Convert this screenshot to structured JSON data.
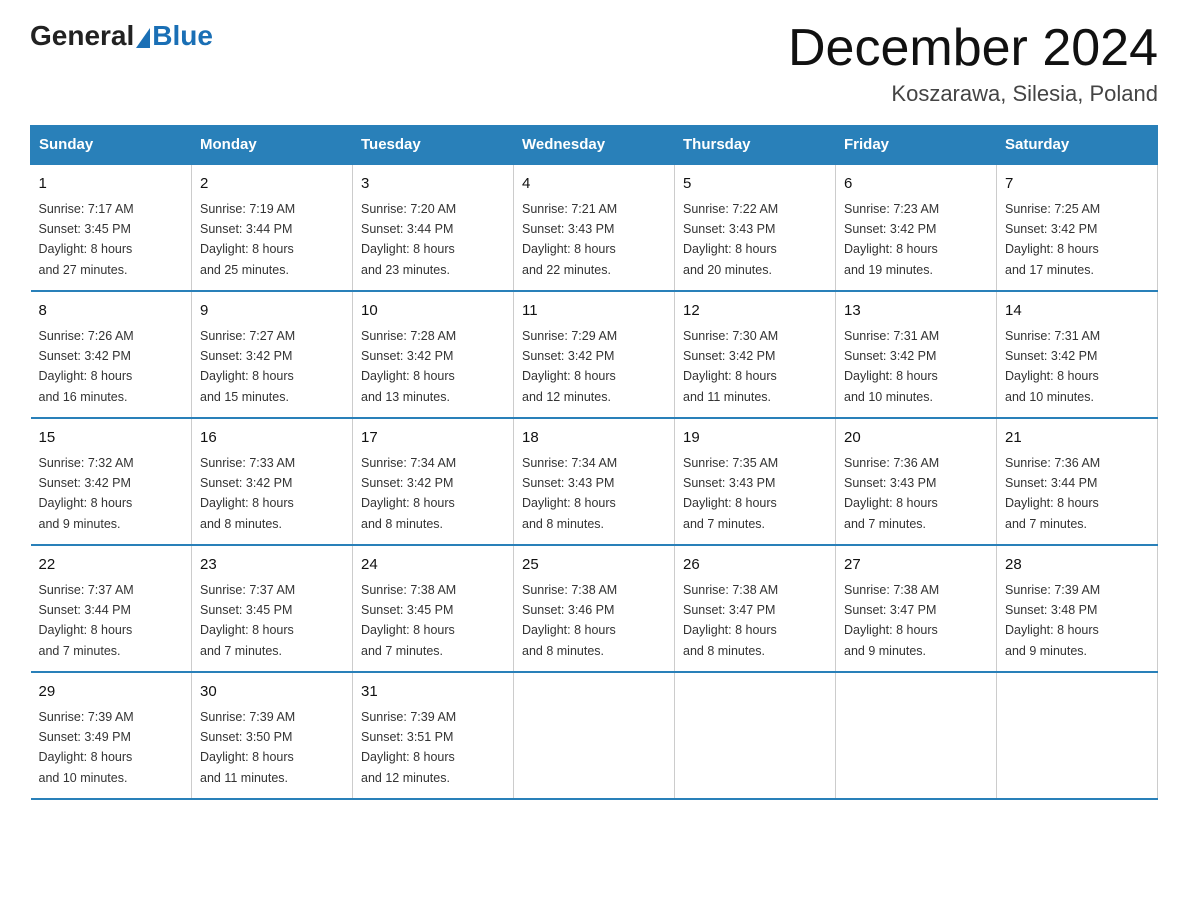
{
  "header": {
    "logo_general": "General",
    "logo_blue": "Blue",
    "title": "December 2024",
    "subtitle": "Koszarawa, Silesia, Poland"
  },
  "weekdays": [
    "Sunday",
    "Monday",
    "Tuesday",
    "Wednesday",
    "Thursday",
    "Friday",
    "Saturday"
  ],
  "weeks": [
    [
      {
        "day": "1",
        "sunrise": "7:17 AM",
        "sunset": "3:45 PM",
        "daylight": "8 hours and 27 minutes."
      },
      {
        "day": "2",
        "sunrise": "7:19 AM",
        "sunset": "3:44 PM",
        "daylight": "8 hours and 25 minutes."
      },
      {
        "day": "3",
        "sunrise": "7:20 AM",
        "sunset": "3:44 PM",
        "daylight": "8 hours and 23 minutes."
      },
      {
        "day": "4",
        "sunrise": "7:21 AM",
        "sunset": "3:43 PM",
        "daylight": "8 hours and 22 minutes."
      },
      {
        "day": "5",
        "sunrise": "7:22 AM",
        "sunset": "3:43 PM",
        "daylight": "8 hours and 20 minutes."
      },
      {
        "day": "6",
        "sunrise": "7:23 AM",
        "sunset": "3:42 PM",
        "daylight": "8 hours and 19 minutes."
      },
      {
        "day": "7",
        "sunrise": "7:25 AM",
        "sunset": "3:42 PM",
        "daylight": "8 hours and 17 minutes."
      }
    ],
    [
      {
        "day": "8",
        "sunrise": "7:26 AM",
        "sunset": "3:42 PM",
        "daylight": "8 hours and 16 minutes."
      },
      {
        "day": "9",
        "sunrise": "7:27 AM",
        "sunset": "3:42 PM",
        "daylight": "8 hours and 15 minutes."
      },
      {
        "day": "10",
        "sunrise": "7:28 AM",
        "sunset": "3:42 PM",
        "daylight": "8 hours and 13 minutes."
      },
      {
        "day": "11",
        "sunrise": "7:29 AM",
        "sunset": "3:42 PM",
        "daylight": "8 hours and 12 minutes."
      },
      {
        "day": "12",
        "sunrise": "7:30 AM",
        "sunset": "3:42 PM",
        "daylight": "8 hours and 11 minutes."
      },
      {
        "day": "13",
        "sunrise": "7:31 AM",
        "sunset": "3:42 PM",
        "daylight": "8 hours and 10 minutes."
      },
      {
        "day": "14",
        "sunrise": "7:31 AM",
        "sunset": "3:42 PM",
        "daylight": "8 hours and 10 minutes."
      }
    ],
    [
      {
        "day": "15",
        "sunrise": "7:32 AM",
        "sunset": "3:42 PM",
        "daylight": "8 hours and 9 minutes."
      },
      {
        "day": "16",
        "sunrise": "7:33 AM",
        "sunset": "3:42 PM",
        "daylight": "8 hours and 8 minutes."
      },
      {
        "day": "17",
        "sunrise": "7:34 AM",
        "sunset": "3:42 PM",
        "daylight": "8 hours and 8 minutes."
      },
      {
        "day": "18",
        "sunrise": "7:34 AM",
        "sunset": "3:43 PM",
        "daylight": "8 hours and 8 minutes."
      },
      {
        "day": "19",
        "sunrise": "7:35 AM",
        "sunset": "3:43 PM",
        "daylight": "8 hours and 7 minutes."
      },
      {
        "day": "20",
        "sunrise": "7:36 AM",
        "sunset": "3:43 PM",
        "daylight": "8 hours and 7 minutes."
      },
      {
        "day": "21",
        "sunrise": "7:36 AM",
        "sunset": "3:44 PM",
        "daylight": "8 hours and 7 minutes."
      }
    ],
    [
      {
        "day": "22",
        "sunrise": "7:37 AM",
        "sunset": "3:44 PM",
        "daylight": "8 hours and 7 minutes."
      },
      {
        "day": "23",
        "sunrise": "7:37 AM",
        "sunset": "3:45 PM",
        "daylight": "8 hours and 7 minutes."
      },
      {
        "day": "24",
        "sunrise": "7:38 AM",
        "sunset": "3:45 PM",
        "daylight": "8 hours and 7 minutes."
      },
      {
        "day": "25",
        "sunrise": "7:38 AM",
        "sunset": "3:46 PM",
        "daylight": "8 hours and 8 minutes."
      },
      {
        "day": "26",
        "sunrise": "7:38 AM",
        "sunset": "3:47 PM",
        "daylight": "8 hours and 8 minutes."
      },
      {
        "day": "27",
        "sunrise": "7:38 AM",
        "sunset": "3:47 PM",
        "daylight": "8 hours and 9 minutes."
      },
      {
        "day": "28",
        "sunrise": "7:39 AM",
        "sunset": "3:48 PM",
        "daylight": "8 hours and 9 minutes."
      }
    ],
    [
      {
        "day": "29",
        "sunrise": "7:39 AM",
        "sunset": "3:49 PM",
        "daylight": "8 hours and 10 minutes."
      },
      {
        "day": "30",
        "sunrise": "7:39 AM",
        "sunset": "3:50 PM",
        "daylight": "8 hours and 11 minutes."
      },
      {
        "day": "31",
        "sunrise": "7:39 AM",
        "sunset": "3:51 PM",
        "daylight": "8 hours and 12 minutes."
      },
      null,
      null,
      null,
      null
    ]
  ],
  "labels": {
    "sunrise": "Sunrise: ",
    "sunset": "Sunset: ",
    "daylight": "Daylight: "
  }
}
